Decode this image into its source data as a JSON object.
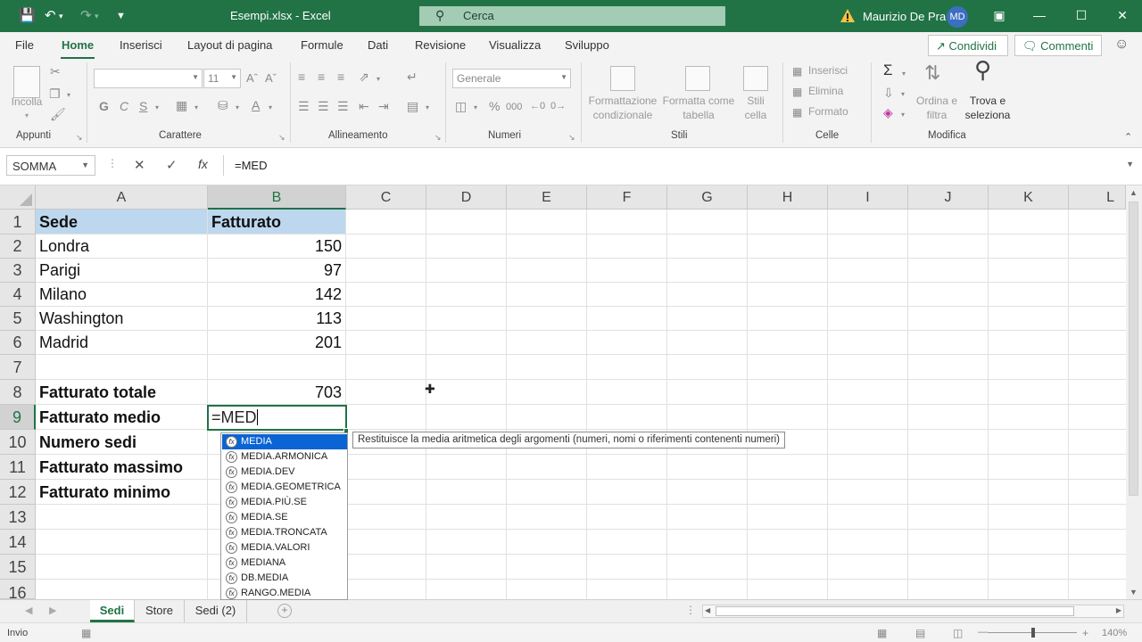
{
  "window": {
    "title": "Esempi.xlsx  -  Excel",
    "search_placeholder": "Cerca",
    "user_name": "Maurizio De Pra",
    "user_initials": "MD",
    "accent_color": "#217346"
  },
  "menu": {
    "tabs": [
      "File",
      "Home",
      "Inserisci",
      "Layout di pagina",
      "Formule",
      "Dati",
      "Revisione",
      "Visualizza",
      "Sviluppo"
    ],
    "active_tab": "Home",
    "share_label": "Condividi",
    "comments_label": "Commenti"
  },
  "ribbon": {
    "groups": [
      "Appunti",
      "Carattere",
      "Allineamento",
      "Numeri",
      "Stili",
      "Celle",
      "Modifica"
    ],
    "paste_label": "Incolla",
    "font_size": "11",
    "bold": "G",
    "italic": "C",
    "underline": "S",
    "number_format": "Generale",
    "conditional_format": [
      "Formattazione",
      "condizionale"
    ],
    "format_table": [
      "Formatta come",
      "tabella"
    ],
    "cell_styles": [
      "Stili",
      "cella"
    ],
    "cells": [
      "Inserisci",
      "Elimina",
      "Formato"
    ],
    "sort_filter": [
      "Ordina e",
      "filtra"
    ],
    "find_select": [
      "Trova e",
      "seleziona"
    ],
    "percent_symbol": "%",
    "thousands_symbol": "000"
  },
  "formula_bar": {
    "name_box": "SOMMA",
    "fx": "fx",
    "formula": "=MED"
  },
  "sheet": {
    "columns": [
      "A",
      "B",
      "C",
      "D",
      "E",
      "F",
      "G",
      "H",
      "I",
      "J",
      "K",
      "L"
    ],
    "rows": [
      "1",
      "2",
      "3",
      "4",
      "5",
      "6",
      "7",
      "8",
      "9",
      "10",
      "11",
      "12",
      "13",
      "14",
      "15",
      "16"
    ],
    "header": {
      "a": "Sede",
      "b": "Fatturato"
    },
    "data": [
      {
        "a": "Londra",
        "b": "150"
      },
      {
        "a": "Parigi",
        "b": "97"
      },
      {
        "a": "Milano",
        "b": "142"
      },
      {
        "a": "Washington",
        "b": "113"
      },
      {
        "a": "Madrid",
        "b": "201"
      }
    ],
    "summary": [
      {
        "a": "Fatturato totale",
        "b": "703"
      },
      {
        "a": "Fatturato medio",
        "b": "=MED"
      },
      {
        "a": "Numero sedi",
        "b": ""
      },
      {
        "a": "Fatturato massimo",
        "b": ""
      },
      {
        "a": "Fatturato minimo",
        "b": ""
      }
    ]
  },
  "autocomplete": {
    "items": [
      "MEDIA",
      "MEDIA.ARMONICA",
      "MEDIA.DEV",
      "MEDIA.GEOMETRICA",
      "MEDIA.PIÙ.SE",
      "MEDIA.SE",
      "MEDIA.TRONCATA",
      "MEDIA.VALORI",
      "MEDIANA",
      "DB.MEDIA",
      "RANGO.MEDIA"
    ],
    "selected": "MEDIA",
    "tooltip": "Restituisce la media aritmetica degli argomenti (numeri, nomi o riferimenti contenenti numeri)"
  },
  "sheet_tabs": {
    "tabs": [
      "Sedi",
      "Store",
      "Sedi (2)"
    ],
    "active": "Sedi"
  },
  "status": {
    "mode": "Invio",
    "zoom": "140%"
  }
}
